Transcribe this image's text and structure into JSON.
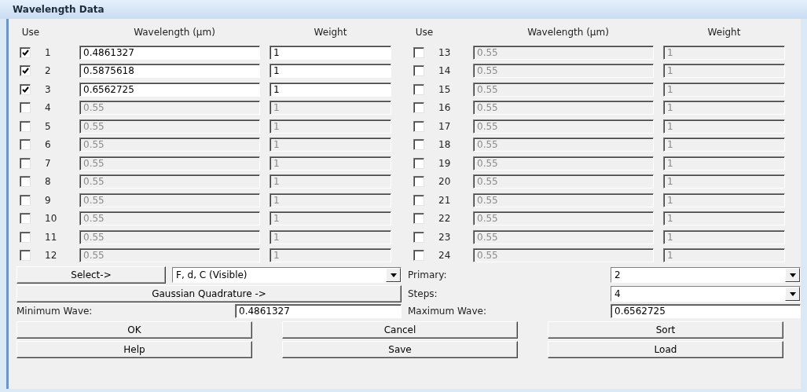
{
  "window": {
    "title": "Wavelength Data"
  },
  "columns": [
    {
      "use": "Use",
      "wavelength": "Wavelength (µm)",
      "weight": "Weight"
    },
    {
      "use": "Use",
      "wavelength": "Wavelength (µm)",
      "weight": "Weight"
    }
  ],
  "wavelengths": [
    {
      "number": "1",
      "checked": true,
      "wavelength": "0.4861327",
      "weight": "1"
    },
    {
      "number": "2",
      "checked": true,
      "wavelength": "0.5875618",
      "weight": "1"
    },
    {
      "number": "3",
      "checked": true,
      "wavelength": "0.6562725",
      "weight": "1"
    },
    {
      "number": "4",
      "checked": false,
      "wavelength": "0.55",
      "weight": "1"
    },
    {
      "number": "5",
      "checked": false,
      "wavelength": "0.55",
      "weight": "1"
    },
    {
      "number": "6",
      "checked": false,
      "wavelength": "0.55",
      "weight": "1"
    },
    {
      "number": "7",
      "checked": false,
      "wavelength": "0.55",
      "weight": "1"
    },
    {
      "number": "8",
      "checked": false,
      "wavelength": "0.55",
      "weight": "1"
    },
    {
      "number": "9",
      "checked": false,
      "wavelength": "0.55",
      "weight": "1"
    },
    {
      "number": "10",
      "checked": false,
      "wavelength": "0.55",
      "weight": "1"
    },
    {
      "number": "11",
      "checked": false,
      "wavelength": "0.55",
      "weight": "1"
    },
    {
      "number": "12",
      "checked": false,
      "wavelength": "0.55",
      "weight": "1"
    },
    {
      "number": "13",
      "checked": false,
      "wavelength": "0.55",
      "weight": "1"
    },
    {
      "number": "14",
      "checked": false,
      "wavelength": "0.55",
      "weight": "1"
    },
    {
      "number": "15",
      "checked": false,
      "wavelength": "0.55",
      "weight": "1"
    },
    {
      "number": "16",
      "checked": false,
      "wavelength": "0.55",
      "weight": "1"
    },
    {
      "number": "17",
      "checked": false,
      "wavelength": "0.55",
      "weight": "1"
    },
    {
      "number": "18",
      "checked": false,
      "wavelength": "0.55",
      "weight": "1"
    },
    {
      "number": "19",
      "checked": false,
      "wavelength": "0.55",
      "weight": "1"
    },
    {
      "number": "20",
      "checked": false,
      "wavelength": "0.55",
      "weight": "1"
    },
    {
      "number": "21",
      "checked": false,
      "wavelength": "0.55",
      "weight": "1"
    },
    {
      "number": "22",
      "checked": false,
      "wavelength": "0.55",
      "weight": "1"
    },
    {
      "number": "23",
      "checked": false,
      "wavelength": "0.55",
      "weight": "1"
    },
    {
      "number": "24",
      "checked": false,
      "wavelength": "0.55",
      "weight": "1"
    }
  ],
  "select_button": "Select->",
  "preset": {
    "value": "F, d, C (Visible)"
  },
  "primary": {
    "label": "Primary:",
    "value": "2"
  },
  "gaussian_button": "Gaussian Quadrature ->",
  "steps": {
    "label": "Steps:",
    "value": "4"
  },
  "minimum_wave": {
    "label": "Minimum Wave:",
    "value": "0.4861327"
  },
  "maximum_wave": {
    "label": "Maximum Wave:",
    "value": "0.6562725"
  },
  "buttons": [
    [
      "OK",
      "Cancel",
      "Sort"
    ],
    [
      "Help",
      "Save",
      "Load"
    ]
  ]
}
